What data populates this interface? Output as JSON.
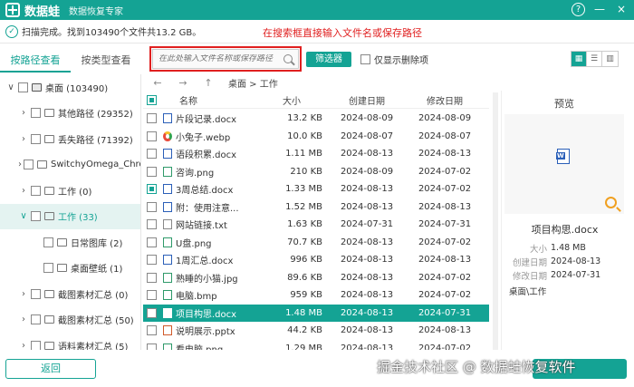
{
  "app": {
    "name": "数据蛙",
    "subtitle": "数据恢复专家",
    "help_glyph": "?",
    "minimize_glyph": "—",
    "close_glyph": "×"
  },
  "status": {
    "text": "扫描完成。找到103490个文件共13.2 GB。"
  },
  "annotation": "在搜索框直接输入文件名或保存路径",
  "tabs": [
    {
      "label": "按路径查看",
      "active": true
    },
    {
      "label": "按类型查看",
      "active": false
    }
  ],
  "toolbar": {
    "search_placeholder": "在此处输入文件名称或保存路径",
    "filter_label": "筛选器",
    "deleted_only_label": "仅显示删除项"
  },
  "tree": [
    {
      "label": "桌面 (103490)",
      "arrow": "∨",
      "icon": "drive",
      "indent": 0,
      "selected": false
    },
    {
      "label": "其他路径 (29352)",
      "arrow": "›",
      "icon": "folder",
      "indent": 1,
      "selected": false
    },
    {
      "label": "丢失路径 (71392)",
      "arrow": "›",
      "icon": "folder",
      "indent": 1,
      "selected": false
    },
    {
      "label": "SwitchyOmega_Chromium",
      "arrow": "›",
      "icon": "folder",
      "indent": 1,
      "selected": false
    },
    {
      "label": "工作 (0)",
      "arrow": "›",
      "icon": "folder",
      "indent": 1,
      "selected": false
    },
    {
      "label": "工作 (33)",
      "arrow": "∨",
      "icon": "folder",
      "indent": 1,
      "selected": true
    },
    {
      "label": "日常图库 (2)",
      "arrow": "",
      "icon": "folder",
      "indent": 2,
      "selected": false
    },
    {
      "label": "桌面壁纸 (1)",
      "arrow": "",
      "icon": "folder",
      "indent": 2,
      "selected": false
    },
    {
      "label": "截图素材汇总 (0)",
      "arrow": "›",
      "icon": "folder",
      "indent": 1,
      "selected": false
    },
    {
      "label": "截图素材汇总 (50)",
      "arrow": "›",
      "icon": "folder",
      "indent": 1,
      "selected": false
    },
    {
      "label": "语料素材汇总 (5)",
      "arrow": "›",
      "icon": "folder",
      "indent": 1,
      "selected": false
    }
  ],
  "nav": {
    "back_glyph": "←",
    "forward_glyph": "→",
    "up_glyph": "↑",
    "breadcrumb": "桌面 > 工作"
  },
  "columns": {
    "name": "名称",
    "size": "大小",
    "created": "创建日期",
    "modified": "修改日期"
  },
  "files": [
    {
      "name": "片段记录.docx",
      "size": "13.2 KB",
      "created": "2024-08-09",
      "modified": "2024-08-09",
      "type": "doc",
      "checked": false,
      "selected": false
    },
    {
      "name": "小兔子.webp",
      "size": "10.0 KB",
      "created": "2024-08-07",
      "modified": "2024-08-07",
      "type": "web",
      "checked": false,
      "selected": false
    },
    {
      "name": "语段积累.docx",
      "size": "1.11 MB",
      "created": "2024-08-13",
      "modified": "2024-08-13",
      "type": "doc",
      "checked": false,
      "selected": false
    },
    {
      "name": "咨询.png",
      "size": "210 KB",
      "created": "2024-08-09",
      "modified": "2024-07-02",
      "type": "img",
      "checked": false,
      "selected": false
    },
    {
      "name": "3周总结.docx",
      "size": "1.33 MB",
      "created": "2024-08-13",
      "modified": "2024-07-02",
      "type": "doc",
      "checked": true,
      "selected": false
    },
    {
      "name": "附：使用注意...",
      "size": "1.52 MB",
      "created": "2024-08-13",
      "modified": "2024-08-13",
      "type": "doc",
      "checked": false,
      "selected": false
    },
    {
      "name": "网站链接.txt",
      "size": "1.63 KB",
      "created": "2024-07-31",
      "modified": "2024-07-31",
      "type": "txt",
      "checked": false,
      "selected": false
    },
    {
      "name": "U盘.png",
      "size": "70.7 KB",
      "created": "2024-08-13",
      "modified": "2024-07-02",
      "type": "img",
      "checked": false,
      "selected": false
    },
    {
      "name": "1周汇总.docx",
      "size": "996 KB",
      "created": "2024-08-13",
      "modified": "2024-08-13",
      "type": "doc",
      "checked": false,
      "selected": false
    },
    {
      "name": "熟睡的小猫.jpg",
      "size": "89.6 KB",
      "created": "2024-08-13",
      "modified": "2024-07-02",
      "type": "img",
      "checked": false,
      "selected": false
    },
    {
      "name": "电脑.bmp",
      "size": "959 KB",
      "created": "2024-08-13",
      "modified": "2024-07-02",
      "type": "img",
      "checked": false,
      "selected": false
    },
    {
      "name": "项目构思.docx",
      "size": "1.48 MB",
      "created": "2024-08-13",
      "modified": "2024-07-31",
      "type": "doc",
      "checked": false,
      "selected": true
    },
    {
      "name": "说明展示.pptx",
      "size": "44.2 KB",
      "created": "2024-08-13",
      "modified": "2024-08-13",
      "type": "ppt",
      "checked": false,
      "selected": false
    },
    {
      "name": "看电脑.png",
      "size": "1.29 MB",
      "created": "2024-08-13",
      "modified": "2024-07-02",
      "type": "img",
      "checked": false,
      "selected": false
    }
  ],
  "preview": {
    "title": "预览",
    "file_name": "项目构思.docx",
    "size_label": "大小",
    "size": "1.48 MB",
    "created_label": "创建日期",
    "created": "2024-08-13",
    "modified_label": "修改日期",
    "modified": "2024-07-31",
    "path": "桌面\\工作"
  },
  "buttons": {
    "back": "返回"
  },
  "watermark": "掘金技术社区 @ 数据蛙恢复软件",
  "colors": {
    "accent": "#14a394",
    "annotation": "#e02020"
  }
}
